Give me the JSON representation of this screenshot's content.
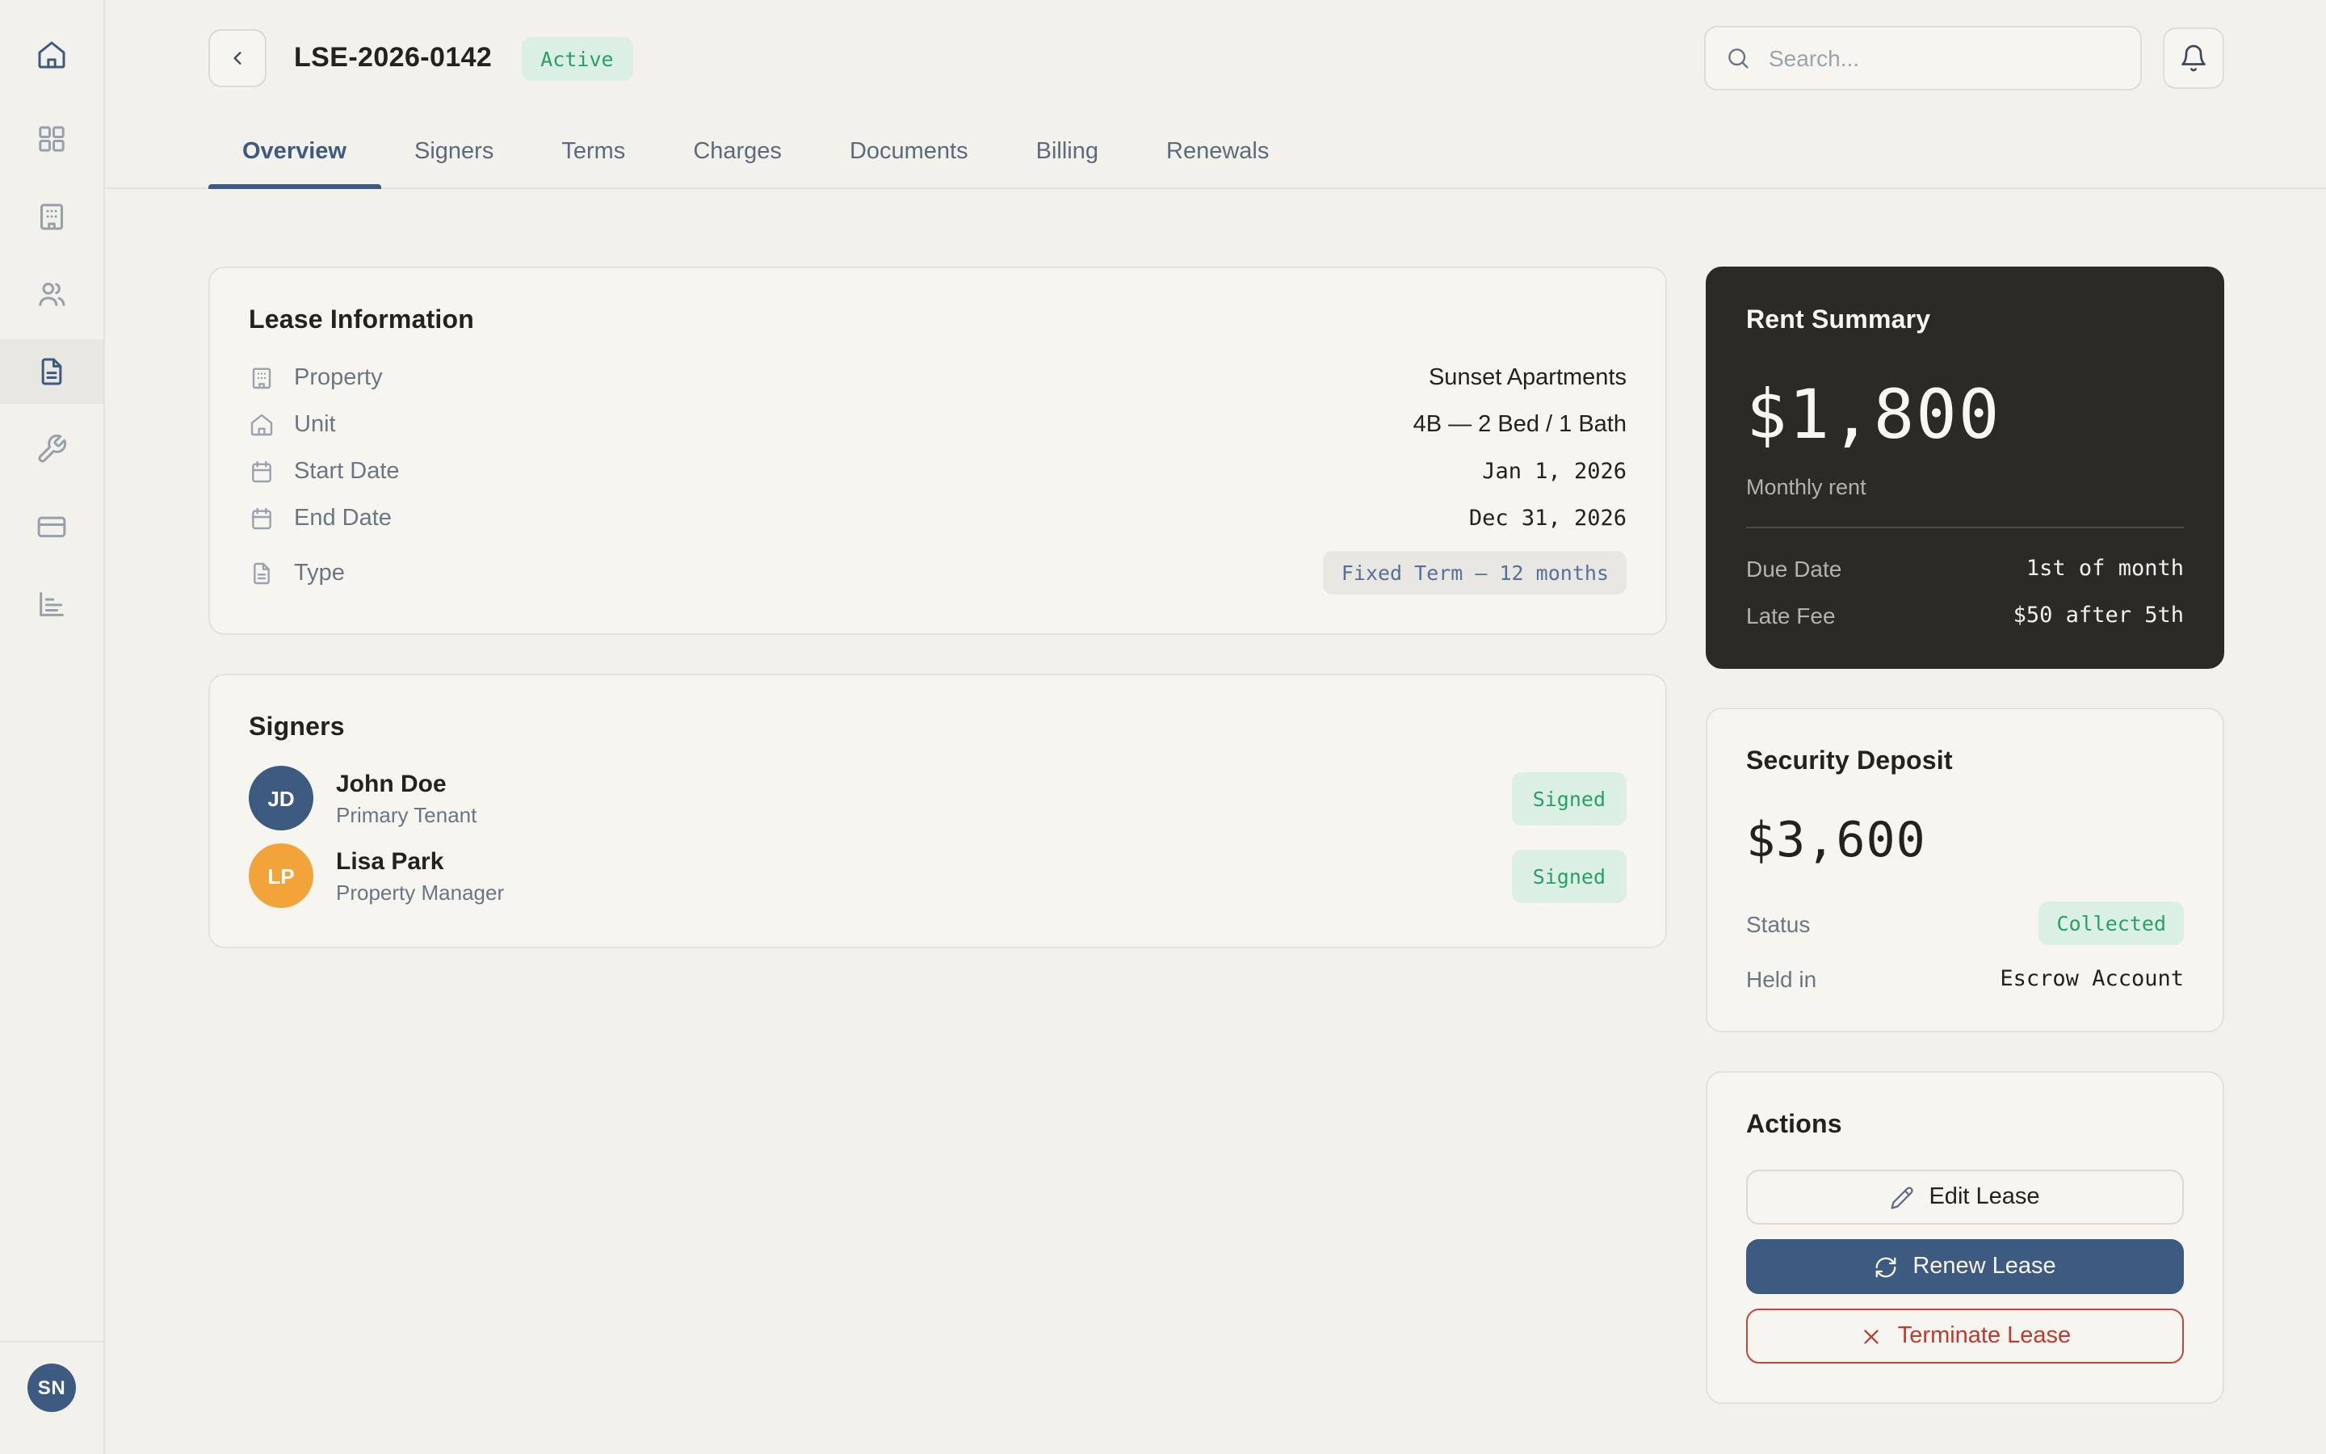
{
  "colors": {
    "accent_navy": "#3d5a80",
    "success_green": "#27a163",
    "success_bg": "#dcefe4",
    "danger_red": "#bf3a31",
    "dark_card_bg": "#2b2a27",
    "avatar_orange": "#f2a33a",
    "page_bg": "#f2f1ec"
  },
  "sidebar": {
    "items": [
      {
        "id": "home",
        "icon": "home-icon",
        "variant": "logo"
      },
      {
        "id": "dashboard",
        "icon": "grid-icon"
      },
      {
        "id": "properties",
        "icon": "building-icon"
      },
      {
        "id": "tenants",
        "icon": "users-icon"
      },
      {
        "id": "leases",
        "icon": "file-text-icon",
        "active": true
      },
      {
        "id": "maintenance",
        "icon": "wrench-icon"
      },
      {
        "id": "payments",
        "icon": "credit-card-icon"
      },
      {
        "id": "reports",
        "icon": "bar-chart-icon"
      }
    ],
    "user_initials": "SN"
  },
  "header": {
    "lease_id": "LSE-2026-0142",
    "status_badge": "Active",
    "search_placeholder": "Search...",
    "tabs": [
      {
        "label": "Overview",
        "active": true
      },
      {
        "label": "Signers"
      },
      {
        "label": "Terms"
      },
      {
        "label": "Charges"
      },
      {
        "label": "Documents"
      },
      {
        "label": "Billing"
      },
      {
        "label": "Renewals"
      }
    ]
  },
  "lease_info": {
    "title": "Lease Information",
    "rows": [
      {
        "icon": "building-icon",
        "label": "Property",
        "value": "Sunset Apartments",
        "style": "text"
      },
      {
        "icon": "house-icon",
        "label": "Unit",
        "value": "4B — 2 Bed / 1 Bath",
        "style": "text"
      },
      {
        "icon": "calendar-icon",
        "label": "Start Date",
        "value": "Jan 1, 2026",
        "style": "mono"
      },
      {
        "icon": "calendar-icon",
        "label": "End Date",
        "value": "Dec 31, 2026",
        "style": "mono"
      },
      {
        "icon": "file-text-icon",
        "label": "Type",
        "value": "Fixed Term — 12 months",
        "style": "badge"
      }
    ]
  },
  "signers": {
    "title": "Signers",
    "rows": [
      {
        "initials": "JD",
        "name": "John Doe",
        "role": "Primary Tenant",
        "status": "Signed",
        "avatar_color": "#3d5a80"
      },
      {
        "initials": "LP",
        "name": "Lisa Park",
        "role": "Property Manager",
        "status": "Signed",
        "avatar_color": "#f2a33a"
      }
    ]
  },
  "rent_summary": {
    "title": "Rent Summary",
    "amount": "$1,800",
    "caption": "Monthly rent",
    "rows": [
      {
        "label": "Due Date",
        "value": "1st of month"
      },
      {
        "label": "Late Fee",
        "value": "$50 after 5th"
      }
    ]
  },
  "security_deposit": {
    "title": "Security Deposit",
    "amount": "$3,600",
    "rows": [
      {
        "label": "Status",
        "value": "Collected",
        "style": "badge"
      },
      {
        "label": "Held in",
        "value": "Escrow Account",
        "style": "mono"
      }
    ]
  },
  "actions": {
    "title": "Actions",
    "buttons": [
      {
        "label": "Edit Lease",
        "icon": "pencil-icon",
        "style": "outline"
      },
      {
        "label": "Renew Lease",
        "icon": "refresh-icon",
        "style": "primary"
      },
      {
        "label": "Terminate Lease",
        "icon": "x-icon",
        "style": "danger"
      }
    ]
  }
}
